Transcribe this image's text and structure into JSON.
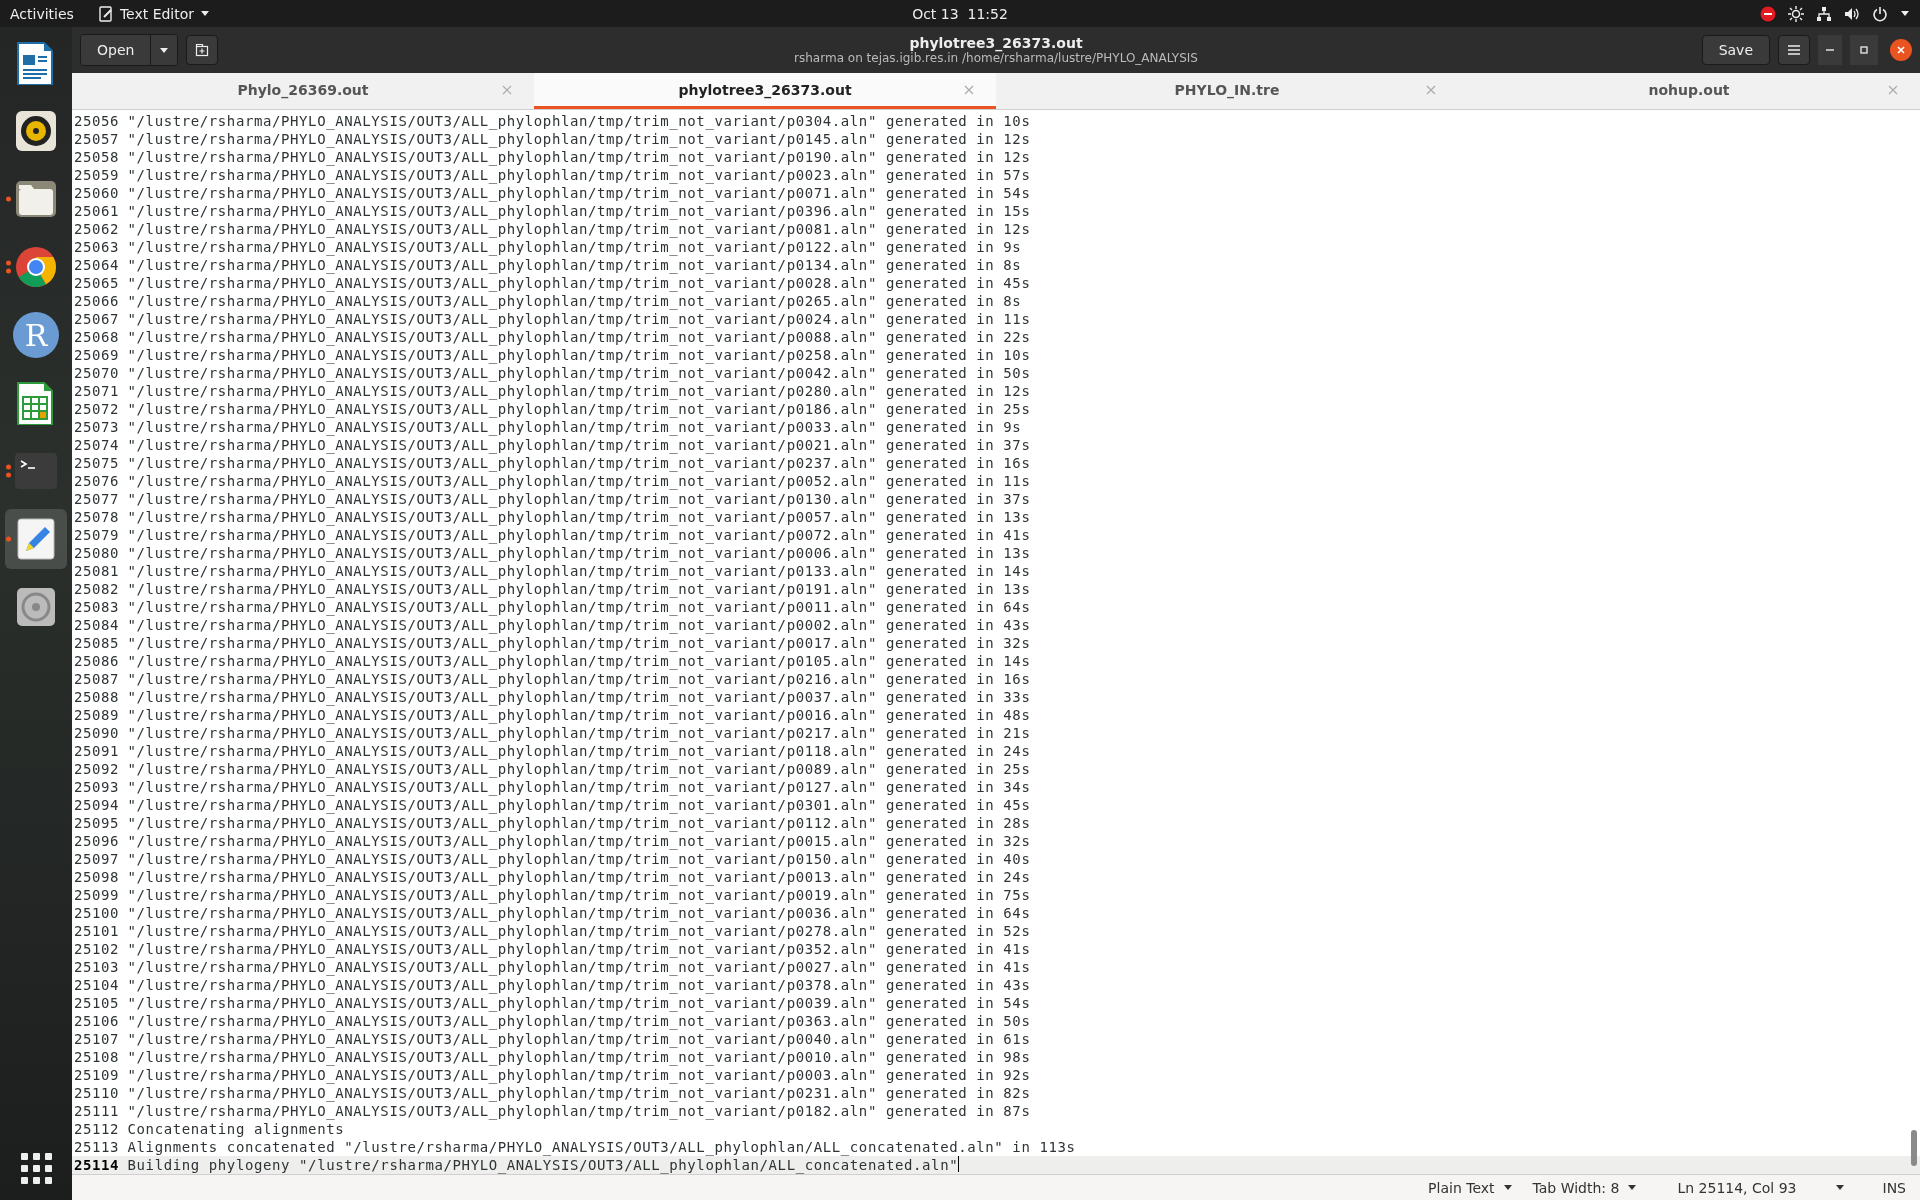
{
  "top_bar": {
    "activities": "Activities",
    "app_menu": "Text Editor",
    "clock": "Oct 13  11:52"
  },
  "dock": [
    {
      "kind": "writer",
      "running": false,
      "multiple": false,
      "selected": false
    },
    {
      "kind": "music",
      "running": false,
      "multiple": false,
      "selected": false
    },
    {
      "kind": "files",
      "running": true,
      "multiple": false,
      "selected": false
    },
    {
      "kind": "browser",
      "running": true,
      "multiple": true,
      "selected": false
    },
    {
      "kind": "letter",
      "glyph": "R",
      "running": false,
      "multiple": false,
      "selected": false
    },
    {
      "kind": "calc",
      "running": false,
      "multiple": false,
      "selected": false
    },
    {
      "kind": "terminal",
      "running": true,
      "multiple": true,
      "selected": false
    },
    {
      "kind": "editor",
      "running": true,
      "multiple": false,
      "selected": true
    },
    {
      "kind": "disc",
      "running": false,
      "multiple": false,
      "selected": false
    }
  ],
  "header": {
    "open_button": "Open",
    "title": "phylotree3_26373.out",
    "subtitle": "rsharma on tejas.igib.res.in /home/rsharma/lustre/PHYLO_ANALYSIS",
    "save_button": "Save"
  },
  "tabs": [
    {
      "label": "Phylo_26369.out",
      "selected": false
    },
    {
      "label": "phylotree3_26373.out",
      "selected": true
    },
    {
      "label": "PHYLO_IN.tre",
      "selected": false
    },
    {
      "label": "nohup.out",
      "selected": false
    }
  ],
  "lines": [
    {
      "number": "25056",
      "text": "\"/lustre/rsharma/PHYLO_ANALYSIS/OUT3/ALL_phylophlan/tmp/trim_not_variant/p0304.aln\" generated in 10s",
      "current": false
    },
    {
      "number": "25057",
      "text": "\"/lustre/rsharma/PHYLO_ANALYSIS/OUT3/ALL_phylophlan/tmp/trim_not_variant/p0145.aln\" generated in 12s",
      "current": false
    },
    {
      "number": "25058",
      "text": "\"/lustre/rsharma/PHYLO_ANALYSIS/OUT3/ALL_phylophlan/tmp/trim_not_variant/p0190.aln\" generated in 12s",
      "current": false
    },
    {
      "number": "25059",
      "text": "\"/lustre/rsharma/PHYLO_ANALYSIS/OUT3/ALL_phylophlan/tmp/trim_not_variant/p0023.aln\" generated in 57s",
      "current": false
    },
    {
      "number": "25060",
      "text": "\"/lustre/rsharma/PHYLO_ANALYSIS/OUT3/ALL_phylophlan/tmp/trim_not_variant/p0071.aln\" generated in 54s",
      "current": false
    },
    {
      "number": "25061",
      "text": "\"/lustre/rsharma/PHYLO_ANALYSIS/OUT3/ALL_phylophlan/tmp/trim_not_variant/p0396.aln\" generated in 15s",
      "current": false
    },
    {
      "number": "25062",
      "text": "\"/lustre/rsharma/PHYLO_ANALYSIS/OUT3/ALL_phylophlan/tmp/trim_not_variant/p0081.aln\" generated in 12s",
      "current": false
    },
    {
      "number": "25063",
      "text": "\"/lustre/rsharma/PHYLO_ANALYSIS/OUT3/ALL_phylophlan/tmp/trim_not_variant/p0122.aln\" generated in 9s",
      "current": false
    },
    {
      "number": "25064",
      "text": "\"/lustre/rsharma/PHYLO_ANALYSIS/OUT3/ALL_phylophlan/tmp/trim_not_variant/p0134.aln\" generated in 8s",
      "current": false
    },
    {
      "number": "25065",
      "text": "\"/lustre/rsharma/PHYLO_ANALYSIS/OUT3/ALL_phylophlan/tmp/trim_not_variant/p0028.aln\" generated in 45s",
      "current": false
    },
    {
      "number": "25066",
      "text": "\"/lustre/rsharma/PHYLO_ANALYSIS/OUT3/ALL_phylophlan/tmp/trim_not_variant/p0265.aln\" generated in 8s",
      "current": false
    },
    {
      "number": "25067",
      "text": "\"/lustre/rsharma/PHYLO_ANALYSIS/OUT3/ALL_phylophlan/tmp/trim_not_variant/p0024.aln\" generated in 11s",
      "current": false
    },
    {
      "number": "25068",
      "text": "\"/lustre/rsharma/PHYLO_ANALYSIS/OUT3/ALL_phylophlan/tmp/trim_not_variant/p0088.aln\" generated in 22s",
      "current": false
    },
    {
      "number": "25069",
      "text": "\"/lustre/rsharma/PHYLO_ANALYSIS/OUT3/ALL_phylophlan/tmp/trim_not_variant/p0258.aln\" generated in 10s",
      "current": false
    },
    {
      "number": "25070",
      "text": "\"/lustre/rsharma/PHYLO_ANALYSIS/OUT3/ALL_phylophlan/tmp/trim_not_variant/p0042.aln\" generated in 50s",
      "current": false
    },
    {
      "number": "25071",
      "text": "\"/lustre/rsharma/PHYLO_ANALYSIS/OUT3/ALL_phylophlan/tmp/trim_not_variant/p0280.aln\" generated in 12s",
      "current": false
    },
    {
      "number": "25072",
      "text": "\"/lustre/rsharma/PHYLO_ANALYSIS/OUT3/ALL_phylophlan/tmp/trim_not_variant/p0186.aln\" generated in 25s",
      "current": false
    },
    {
      "number": "25073",
      "text": "\"/lustre/rsharma/PHYLO_ANALYSIS/OUT3/ALL_phylophlan/tmp/trim_not_variant/p0033.aln\" generated in 9s",
      "current": false
    },
    {
      "number": "25074",
      "text": "\"/lustre/rsharma/PHYLO_ANALYSIS/OUT3/ALL_phylophlan/tmp/trim_not_variant/p0021.aln\" generated in 37s",
      "current": false
    },
    {
      "number": "25075",
      "text": "\"/lustre/rsharma/PHYLO_ANALYSIS/OUT3/ALL_phylophlan/tmp/trim_not_variant/p0237.aln\" generated in 16s",
      "current": false
    },
    {
      "number": "25076",
      "text": "\"/lustre/rsharma/PHYLO_ANALYSIS/OUT3/ALL_phylophlan/tmp/trim_not_variant/p0052.aln\" generated in 11s",
      "current": false
    },
    {
      "number": "25077",
      "text": "\"/lustre/rsharma/PHYLO_ANALYSIS/OUT3/ALL_phylophlan/tmp/trim_not_variant/p0130.aln\" generated in 37s",
      "current": false
    },
    {
      "number": "25078",
      "text": "\"/lustre/rsharma/PHYLO_ANALYSIS/OUT3/ALL_phylophlan/tmp/trim_not_variant/p0057.aln\" generated in 13s",
      "current": false
    },
    {
      "number": "25079",
      "text": "\"/lustre/rsharma/PHYLO_ANALYSIS/OUT3/ALL_phylophlan/tmp/trim_not_variant/p0072.aln\" generated in 41s",
      "current": false
    },
    {
      "number": "25080",
      "text": "\"/lustre/rsharma/PHYLO_ANALYSIS/OUT3/ALL_phylophlan/tmp/trim_not_variant/p0006.aln\" generated in 13s",
      "current": false
    },
    {
      "number": "25081",
      "text": "\"/lustre/rsharma/PHYLO_ANALYSIS/OUT3/ALL_phylophlan/tmp/trim_not_variant/p0133.aln\" generated in 14s",
      "current": false
    },
    {
      "number": "25082",
      "text": "\"/lustre/rsharma/PHYLO_ANALYSIS/OUT3/ALL_phylophlan/tmp/trim_not_variant/p0191.aln\" generated in 13s",
      "current": false
    },
    {
      "number": "25083",
      "text": "\"/lustre/rsharma/PHYLO_ANALYSIS/OUT3/ALL_phylophlan/tmp/trim_not_variant/p0011.aln\" generated in 64s",
      "current": false
    },
    {
      "number": "25084",
      "text": "\"/lustre/rsharma/PHYLO_ANALYSIS/OUT3/ALL_phylophlan/tmp/trim_not_variant/p0002.aln\" generated in 43s",
      "current": false
    },
    {
      "number": "25085",
      "text": "\"/lustre/rsharma/PHYLO_ANALYSIS/OUT3/ALL_phylophlan/tmp/trim_not_variant/p0017.aln\" generated in 32s",
      "current": false
    },
    {
      "number": "25086",
      "text": "\"/lustre/rsharma/PHYLO_ANALYSIS/OUT3/ALL_phylophlan/tmp/trim_not_variant/p0105.aln\" generated in 14s",
      "current": false
    },
    {
      "number": "25087",
      "text": "\"/lustre/rsharma/PHYLO_ANALYSIS/OUT3/ALL_phylophlan/tmp/trim_not_variant/p0216.aln\" generated in 16s",
      "current": false
    },
    {
      "number": "25088",
      "text": "\"/lustre/rsharma/PHYLO_ANALYSIS/OUT3/ALL_phylophlan/tmp/trim_not_variant/p0037.aln\" generated in 33s",
      "current": false
    },
    {
      "number": "25089",
      "text": "\"/lustre/rsharma/PHYLO_ANALYSIS/OUT3/ALL_phylophlan/tmp/trim_not_variant/p0016.aln\" generated in 48s",
      "current": false
    },
    {
      "number": "25090",
      "text": "\"/lustre/rsharma/PHYLO_ANALYSIS/OUT3/ALL_phylophlan/tmp/trim_not_variant/p0217.aln\" generated in 21s",
      "current": false
    },
    {
      "number": "25091",
      "text": "\"/lustre/rsharma/PHYLO_ANALYSIS/OUT3/ALL_phylophlan/tmp/trim_not_variant/p0118.aln\" generated in 24s",
      "current": false
    },
    {
      "number": "25092",
      "text": "\"/lustre/rsharma/PHYLO_ANALYSIS/OUT3/ALL_phylophlan/tmp/trim_not_variant/p0089.aln\" generated in 25s",
      "current": false
    },
    {
      "number": "25093",
      "text": "\"/lustre/rsharma/PHYLO_ANALYSIS/OUT3/ALL_phylophlan/tmp/trim_not_variant/p0127.aln\" generated in 34s",
      "current": false
    },
    {
      "number": "25094",
      "text": "\"/lustre/rsharma/PHYLO_ANALYSIS/OUT3/ALL_phylophlan/tmp/trim_not_variant/p0301.aln\" generated in 45s",
      "current": false
    },
    {
      "number": "25095",
      "text": "\"/lustre/rsharma/PHYLO_ANALYSIS/OUT3/ALL_phylophlan/tmp/trim_not_variant/p0112.aln\" generated in 28s",
      "current": false
    },
    {
      "number": "25096",
      "text": "\"/lustre/rsharma/PHYLO_ANALYSIS/OUT3/ALL_phylophlan/tmp/trim_not_variant/p0015.aln\" generated in 32s",
      "current": false
    },
    {
      "number": "25097",
      "text": "\"/lustre/rsharma/PHYLO_ANALYSIS/OUT3/ALL_phylophlan/tmp/trim_not_variant/p0150.aln\" generated in 40s",
      "current": false
    },
    {
      "number": "25098",
      "text": "\"/lustre/rsharma/PHYLO_ANALYSIS/OUT3/ALL_phylophlan/tmp/trim_not_variant/p0013.aln\" generated in 24s",
      "current": false
    },
    {
      "number": "25099",
      "text": "\"/lustre/rsharma/PHYLO_ANALYSIS/OUT3/ALL_phylophlan/tmp/trim_not_variant/p0019.aln\" generated in 75s",
      "current": false
    },
    {
      "number": "25100",
      "text": "\"/lustre/rsharma/PHYLO_ANALYSIS/OUT3/ALL_phylophlan/tmp/trim_not_variant/p0036.aln\" generated in 64s",
      "current": false
    },
    {
      "number": "25101",
      "text": "\"/lustre/rsharma/PHYLO_ANALYSIS/OUT3/ALL_phylophlan/tmp/trim_not_variant/p0278.aln\" generated in 52s",
      "current": false
    },
    {
      "number": "25102",
      "text": "\"/lustre/rsharma/PHYLO_ANALYSIS/OUT3/ALL_phylophlan/tmp/trim_not_variant/p0352.aln\" generated in 41s",
      "current": false
    },
    {
      "number": "25103",
      "text": "\"/lustre/rsharma/PHYLO_ANALYSIS/OUT3/ALL_phylophlan/tmp/trim_not_variant/p0027.aln\" generated in 41s",
      "current": false
    },
    {
      "number": "25104",
      "text": "\"/lustre/rsharma/PHYLO_ANALYSIS/OUT3/ALL_phylophlan/tmp/trim_not_variant/p0378.aln\" generated in 43s",
      "current": false
    },
    {
      "number": "25105",
      "text": "\"/lustre/rsharma/PHYLO_ANALYSIS/OUT3/ALL_phylophlan/tmp/trim_not_variant/p0039.aln\" generated in 54s",
      "current": false
    },
    {
      "number": "25106",
      "text": "\"/lustre/rsharma/PHYLO_ANALYSIS/OUT3/ALL_phylophlan/tmp/trim_not_variant/p0363.aln\" generated in 50s",
      "current": false
    },
    {
      "number": "25107",
      "text": "\"/lustre/rsharma/PHYLO_ANALYSIS/OUT3/ALL_phylophlan/tmp/trim_not_variant/p0040.aln\" generated in 61s",
      "current": false
    },
    {
      "number": "25108",
      "text": "\"/lustre/rsharma/PHYLO_ANALYSIS/OUT3/ALL_phylophlan/tmp/trim_not_variant/p0010.aln\" generated in 98s",
      "current": false
    },
    {
      "number": "25109",
      "text": "\"/lustre/rsharma/PHYLO_ANALYSIS/OUT3/ALL_phylophlan/tmp/trim_not_variant/p0003.aln\" generated in 92s",
      "current": false
    },
    {
      "number": "25110",
      "text": "\"/lustre/rsharma/PHYLO_ANALYSIS/OUT3/ALL_phylophlan/tmp/trim_not_variant/p0231.aln\" generated in 82s",
      "current": false
    },
    {
      "number": "25111",
      "text": "\"/lustre/rsharma/PHYLO_ANALYSIS/OUT3/ALL_phylophlan/tmp/trim_not_variant/p0182.aln\" generated in 87s",
      "current": false
    },
    {
      "number": "25112",
      "text": "Concatenating alignments",
      "current": false
    },
    {
      "number": "25113",
      "text": "Alignments concatenated \"/lustre/rsharma/PHYLO_ANALYSIS/OUT3/ALL_phylophlan/ALL_concatenated.aln\" in 113s",
      "current": false
    },
    {
      "number": "25114",
      "text": "Building phylogeny \"/lustre/rsharma/PHYLO_ANALYSIS/OUT3/ALL_phylophlan/ALL_concatenated.aln\"",
      "current": true
    }
  ],
  "status_bar": {
    "language": "Plain Text",
    "tab_width": "Tab Width: 8",
    "position": "Ln 25114, Col 93",
    "mode": "INS"
  }
}
